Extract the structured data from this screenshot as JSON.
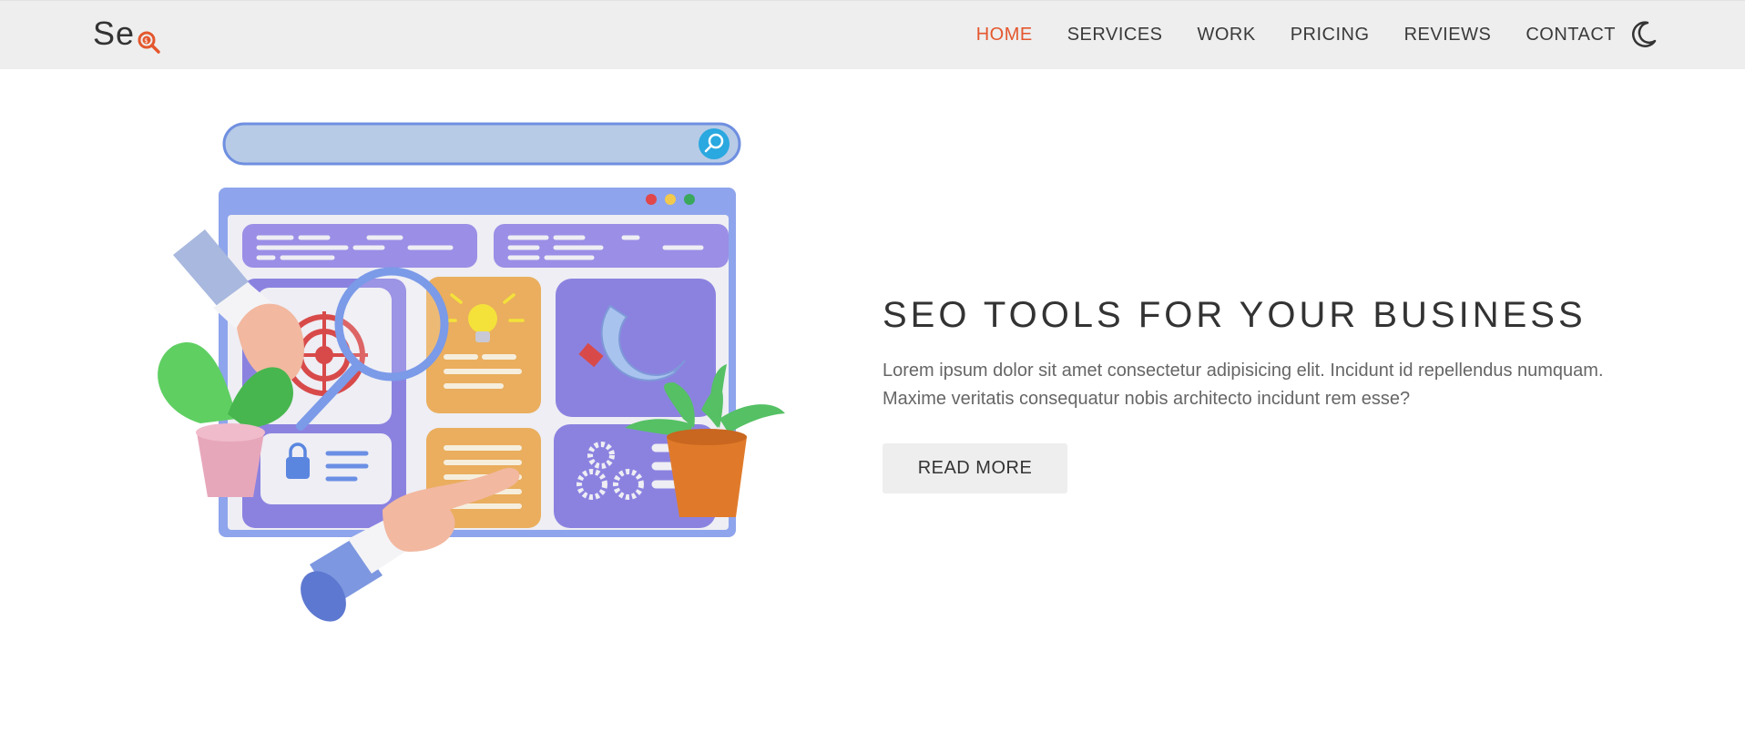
{
  "brand": {
    "logo_text": "Se",
    "logo_icon": "magnifier-dollar-icon",
    "accent": "#e4572e"
  },
  "nav": {
    "items": [
      {
        "label": "HOME",
        "active": true
      },
      {
        "label": "SERVICES",
        "active": false
      },
      {
        "label": "WORK",
        "active": false
      },
      {
        "label": "PRICING",
        "active": false
      },
      {
        "label": "REVIEWS",
        "active": false
      },
      {
        "label": "CONTACT",
        "active": false
      }
    ],
    "theme_icon": "moon-icon"
  },
  "hero": {
    "title": "SEO TOOLS FOR YOUR BUSINESS",
    "description": "Lorem ipsum dolor sit amet consectetur adipisicing elit. Incidunt id repellendus numquam. Maxime veritatis consequatur nobis architecto incidunt rem esse?",
    "button_label": "READ MORE",
    "illustration": "seo-dashboard-illustration"
  },
  "colors": {
    "navbar_bg": "#eeeeee",
    "button_bg": "#eeeeee",
    "text": "#333333",
    "muted_text": "#666666"
  }
}
